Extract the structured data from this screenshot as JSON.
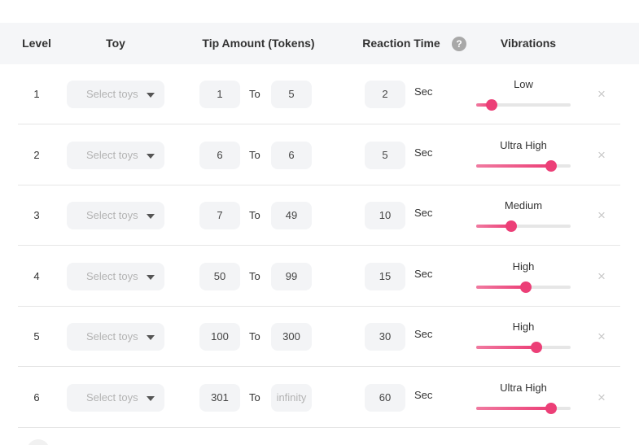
{
  "header": {
    "level": "Level",
    "toy": "Toy",
    "tip_amount": "Tip Amount (Tokens)",
    "reaction_time": "Reaction Time",
    "help": "?",
    "vibrations": "Vibrations"
  },
  "labels": {
    "to": "To",
    "sec": "Sec",
    "remove": "×"
  },
  "rows": [
    {
      "level": "1",
      "toy_placeholder": "Select toys",
      "from": "1",
      "to": "5",
      "to_is_placeholder": false,
      "reaction": "2",
      "vibration": "Low",
      "vibration_level": 0.16
    },
    {
      "level": "2",
      "toy_placeholder": "Select toys",
      "from": "6",
      "to": "6",
      "to_is_placeholder": false,
      "reaction": "5",
      "vibration": "Ultra High",
      "vibration_level": 0.79
    },
    {
      "level": "3",
      "toy_placeholder": "Select toys",
      "from": "7",
      "to": "49",
      "to_is_placeholder": false,
      "reaction": "10",
      "vibration": "Medium",
      "vibration_level": 0.37
    },
    {
      "level": "4",
      "toy_placeholder": "Select toys",
      "from": "50",
      "to": "99",
      "to_is_placeholder": false,
      "reaction": "15",
      "vibration": "High",
      "vibration_level": 0.53
    },
    {
      "level": "5",
      "toy_placeholder": "Select toys",
      "from": "100",
      "to": "300",
      "to_is_placeholder": false,
      "reaction": "30",
      "vibration": "High",
      "vibration_level": 0.64
    },
    {
      "level": "6",
      "toy_placeholder": "Select toys",
      "from": "301",
      "to": "infinity",
      "to_is_placeholder": true,
      "reaction": "60",
      "vibration": "Ultra High",
      "vibration_level": 0.79
    }
  ],
  "colors": {
    "accent": "#ec3f77",
    "header_bg": "#f5f6f8",
    "input_bg": "#f3f4f6"
  }
}
